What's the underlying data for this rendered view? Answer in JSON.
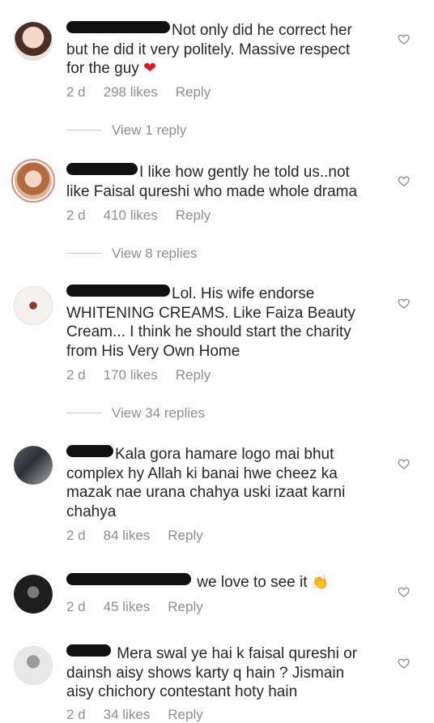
{
  "comments": [
    {
      "text_lines": [
        "Not only did he correct her",
        "but he did it very politely. Massive respect",
        "for the guy"
      ],
      "emoji": "❤",
      "time": "2 d",
      "likes": "298 likes",
      "reply_label": "Reply",
      "view_replies": "View 1 reply"
    },
    {
      "text_lines": [
        "I like how gently he told us..not",
        "like Faisal qureshi who made whole drama"
      ],
      "time": "2 d",
      "likes": "410 likes",
      "reply_label": "Reply",
      "view_replies": "View 8 replies"
    },
    {
      "text_lines": [
        "Lol. His wife endorse",
        "WHITENING CREAMS. Like Faiza Beauty",
        "Cream... I think he should start the charity",
        "from His Very Own Home"
      ],
      "time": "2 d",
      "likes": "170 likes",
      "reply_label": "Reply",
      "view_replies": "View 34 replies"
    },
    {
      "text_lines": [
        "Kala gora hamare logo mai bhut",
        "complex hy Allah ki banai hwe cheez ka",
        "mazak nae urana chahya uski izaat karni",
        "chahya"
      ],
      "time": "2 d",
      "likes": "84 likes",
      "reply_label": "Reply"
    },
    {
      "text_lines": [
        "we love to see it"
      ],
      "emoji": "👏",
      "time": "2 d",
      "likes": "45 likes",
      "reply_label": "Reply"
    },
    {
      "text_lines": [
        "Mera swal ye hai k faisal qureshi or",
        "dainsh aisy shows karty q hain ? Jismain",
        "aisy chichory contestant hoty hain"
      ],
      "time": "2 d",
      "likes": "34 likes",
      "reply_label": "Reply"
    }
  ],
  "colors": {
    "text": "#262626",
    "meta": "#8e8e8e",
    "heart": "#e0151e"
  },
  "icons": {
    "like": "heart-outline-icon"
  }
}
